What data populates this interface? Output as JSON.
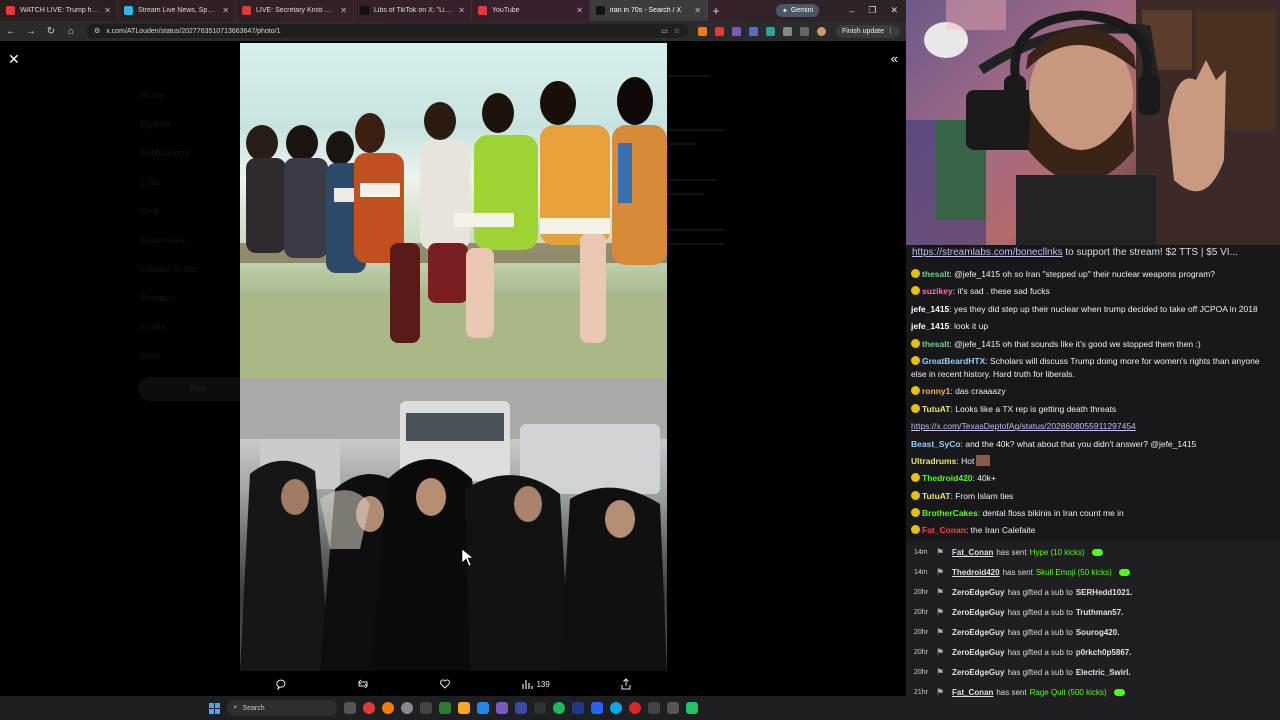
{
  "browser": {
    "tabs": [
      {
        "title": "WATCH LIVE: Trump hosts bilat",
        "color": "#e53935",
        "active": false
      },
      {
        "title": "Stream Live News, Sports, and",
        "color": "#29b6f6",
        "active": false
      },
      {
        "title": "LIVE: Secretary Kristi Noem Tes",
        "color": "#e53935",
        "active": false
      },
      {
        "title": "Libs of TikTok on X: \"Liberal sa",
        "color": "#111111",
        "active": false
      },
      {
        "title": "YouTube",
        "color": "#e53935",
        "active": false
      },
      {
        "title": "iran in 70s - Search / X",
        "color": "#111111",
        "active": true
      }
    ],
    "new_tab": "+",
    "gemini_label": "Gemini",
    "url": "x.com/ATLouden/status/2027763510713663647/photo/1",
    "finish_update": "Finish update",
    "window_controls": [
      "–",
      "❐",
      "✕"
    ]
  },
  "viewer": {
    "close_glyph": "✕",
    "collapse_glyph": "«",
    "nav_ghost": [
      "Home",
      "Explore",
      "Notifications",
      "Chat",
      "Grok",
      "Bookmarks",
      "Creator Studio",
      "Premium",
      "Profile",
      "More"
    ],
    "post_ghost": "Post",
    "views_count": "139"
  },
  "taskbar": {
    "search_placeholder": "Search"
  },
  "chat": {
    "support_link": "https://streamlabs.com/bonecllnks",
    "support_text": " to support the stream! $2 TTS | $5 VI...",
    "messages": [
      {
        "user": "thesalt",
        "color": "#6fd18f",
        "badge": "#e6c200",
        "text": "@jefe_1415 oh so Iran \"stepped up\" their nuclear weapons program?"
      },
      {
        "user": "suzikey",
        "color": "#ff69c0",
        "badge": "#e6c200",
        "text": "it's sad . these sad fucks"
      },
      {
        "user": "jefe_1415",
        "color": "#ffffff",
        "badge": "",
        "text": "yes they did step up their nuclear when trump decided to take off JCPOA in 2018"
      },
      {
        "user": "jefe_1415",
        "color": "#ffffff",
        "badge": "",
        "text": "look it up"
      },
      {
        "user": "thesalt",
        "color": "#6fd18f",
        "badge": "#e6c200",
        "text": "@jefe_1415 oh that sounds like it's good we stopped them then :)"
      },
      {
        "user": "GreatBeardHTX",
        "color": "#8fd0ff",
        "badge": "#e6c200",
        "text": "Scholars will discuss Trump doing more for women's rights than anyone else in recent history. Hard truth for liberals."
      },
      {
        "user": "ronny1",
        "color": "#f2b24a",
        "badge": "#e6c200",
        "text": "das craaaazy"
      },
      {
        "user": "TutuAT",
        "color": "#e6e36a",
        "badge": "#e6c200",
        "text": "Looks like a TX rep is getting death threats"
      },
      {
        "user": "",
        "color": "#bdbdf7",
        "badge": "",
        "text": "https://x.com/TexasDeptofAg/status/2028608055911297454",
        "link": true
      },
      {
        "user": "Beast_SyCo",
        "color": "#8fd0ff",
        "badge": "",
        "text": "and the 40k? what about that you didn't answer? @jefe_1415"
      },
      {
        "user": "Ultradrums",
        "color": "#e6e36a",
        "badge": "",
        "text": "Hot",
        "emote": true
      },
      {
        "user": "Thedroid420",
        "color": "#53fc18",
        "badge": "#e6c200",
        "text": "40k+"
      },
      {
        "user": "TutuAT",
        "color": "#e6e36a",
        "badge": "#e6c200",
        "text": "From Islam ties"
      },
      {
        "user": "BrotherCakes",
        "color": "#53fc18",
        "badge": "#e6c200",
        "text": "dental floss bikinis in Iran count me in"
      },
      {
        "user": "Fat_Conan",
        "color": "#ff4040",
        "badge": "#e6c200",
        "text": "the Iran Calefaite"
      }
    ],
    "events": [
      {
        "time": "14m",
        "who": "Fat_Conan",
        "underline": true,
        "action": "has sent",
        "gift": "Hype (10 kicks)",
        "target": "",
        "pill": true
      },
      {
        "time": "14m",
        "who": "Thedroid420",
        "underline": true,
        "action": "has sent",
        "gift": "Skull Emoji (50 kicks)",
        "target": "",
        "pill": true
      },
      {
        "time": "20hr",
        "who": "ZeroEdgeGuy",
        "underline": false,
        "action": "has gifted a sub to",
        "gift": "",
        "target": "SERHedd1021.",
        "pill": false
      },
      {
        "time": "20hr",
        "who": "ZeroEdgeGuy",
        "underline": false,
        "action": "has gifted a sub to",
        "gift": "",
        "target": "Truthman57.",
        "pill": false
      },
      {
        "time": "20hr",
        "who": "ZeroEdgeGuy",
        "underline": false,
        "action": "has gifted a sub to",
        "gift": "",
        "target": "Sourog420.",
        "pill": false
      },
      {
        "time": "20hr",
        "who": "ZeroEdgeGuy",
        "underline": false,
        "action": "has gifted a sub to",
        "gift": "",
        "target": "p0rkch0p5867.",
        "pill": false
      },
      {
        "time": "20hr",
        "who": "ZeroEdgeGuy",
        "underline": false,
        "action": "has gifted a sub to",
        "gift": "",
        "target": "Electric_Swirl.",
        "pill": false
      },
      {
        "time": "21hr",
        "who": "Fat_Conan",
        "underline": true,
        "action": "has sent",
        "gift": "Rage Quit (500 kicks)",
        "target": "",
        "pill": true
      }
    ]
  }
}
